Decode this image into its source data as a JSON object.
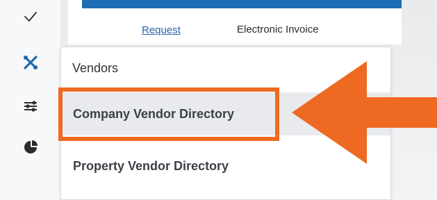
{
  "sidebar": {
    "icons": [
      {
        "name": "checkmark-icon"
      },
      {
        "name": "tools-icon",
        "color": "#1f6aa8"
      },
      {
        "name": "sliders-icon"
      },
      {
        "name": "pie-chart-icon"
      }
    ]
  },
  "content": {
    "request_link": "Request",
    "electronic_invoice": "Electronic Invoice",
    "accent_color": "#1b6cb4"
  },
  "menu": {
    "header": "Vendors",
    "items": [
      {
        "label": "Company Vendor Directory",
        "highlighted": true
      },
      {
        "label": "Property Vendor Directory",
        "highlighted": false
      }
    ]
  },
  "annotation": {
    "color": "#ee6a22",
    "arrow_icon": "arrow-left-icon"
  }
}
